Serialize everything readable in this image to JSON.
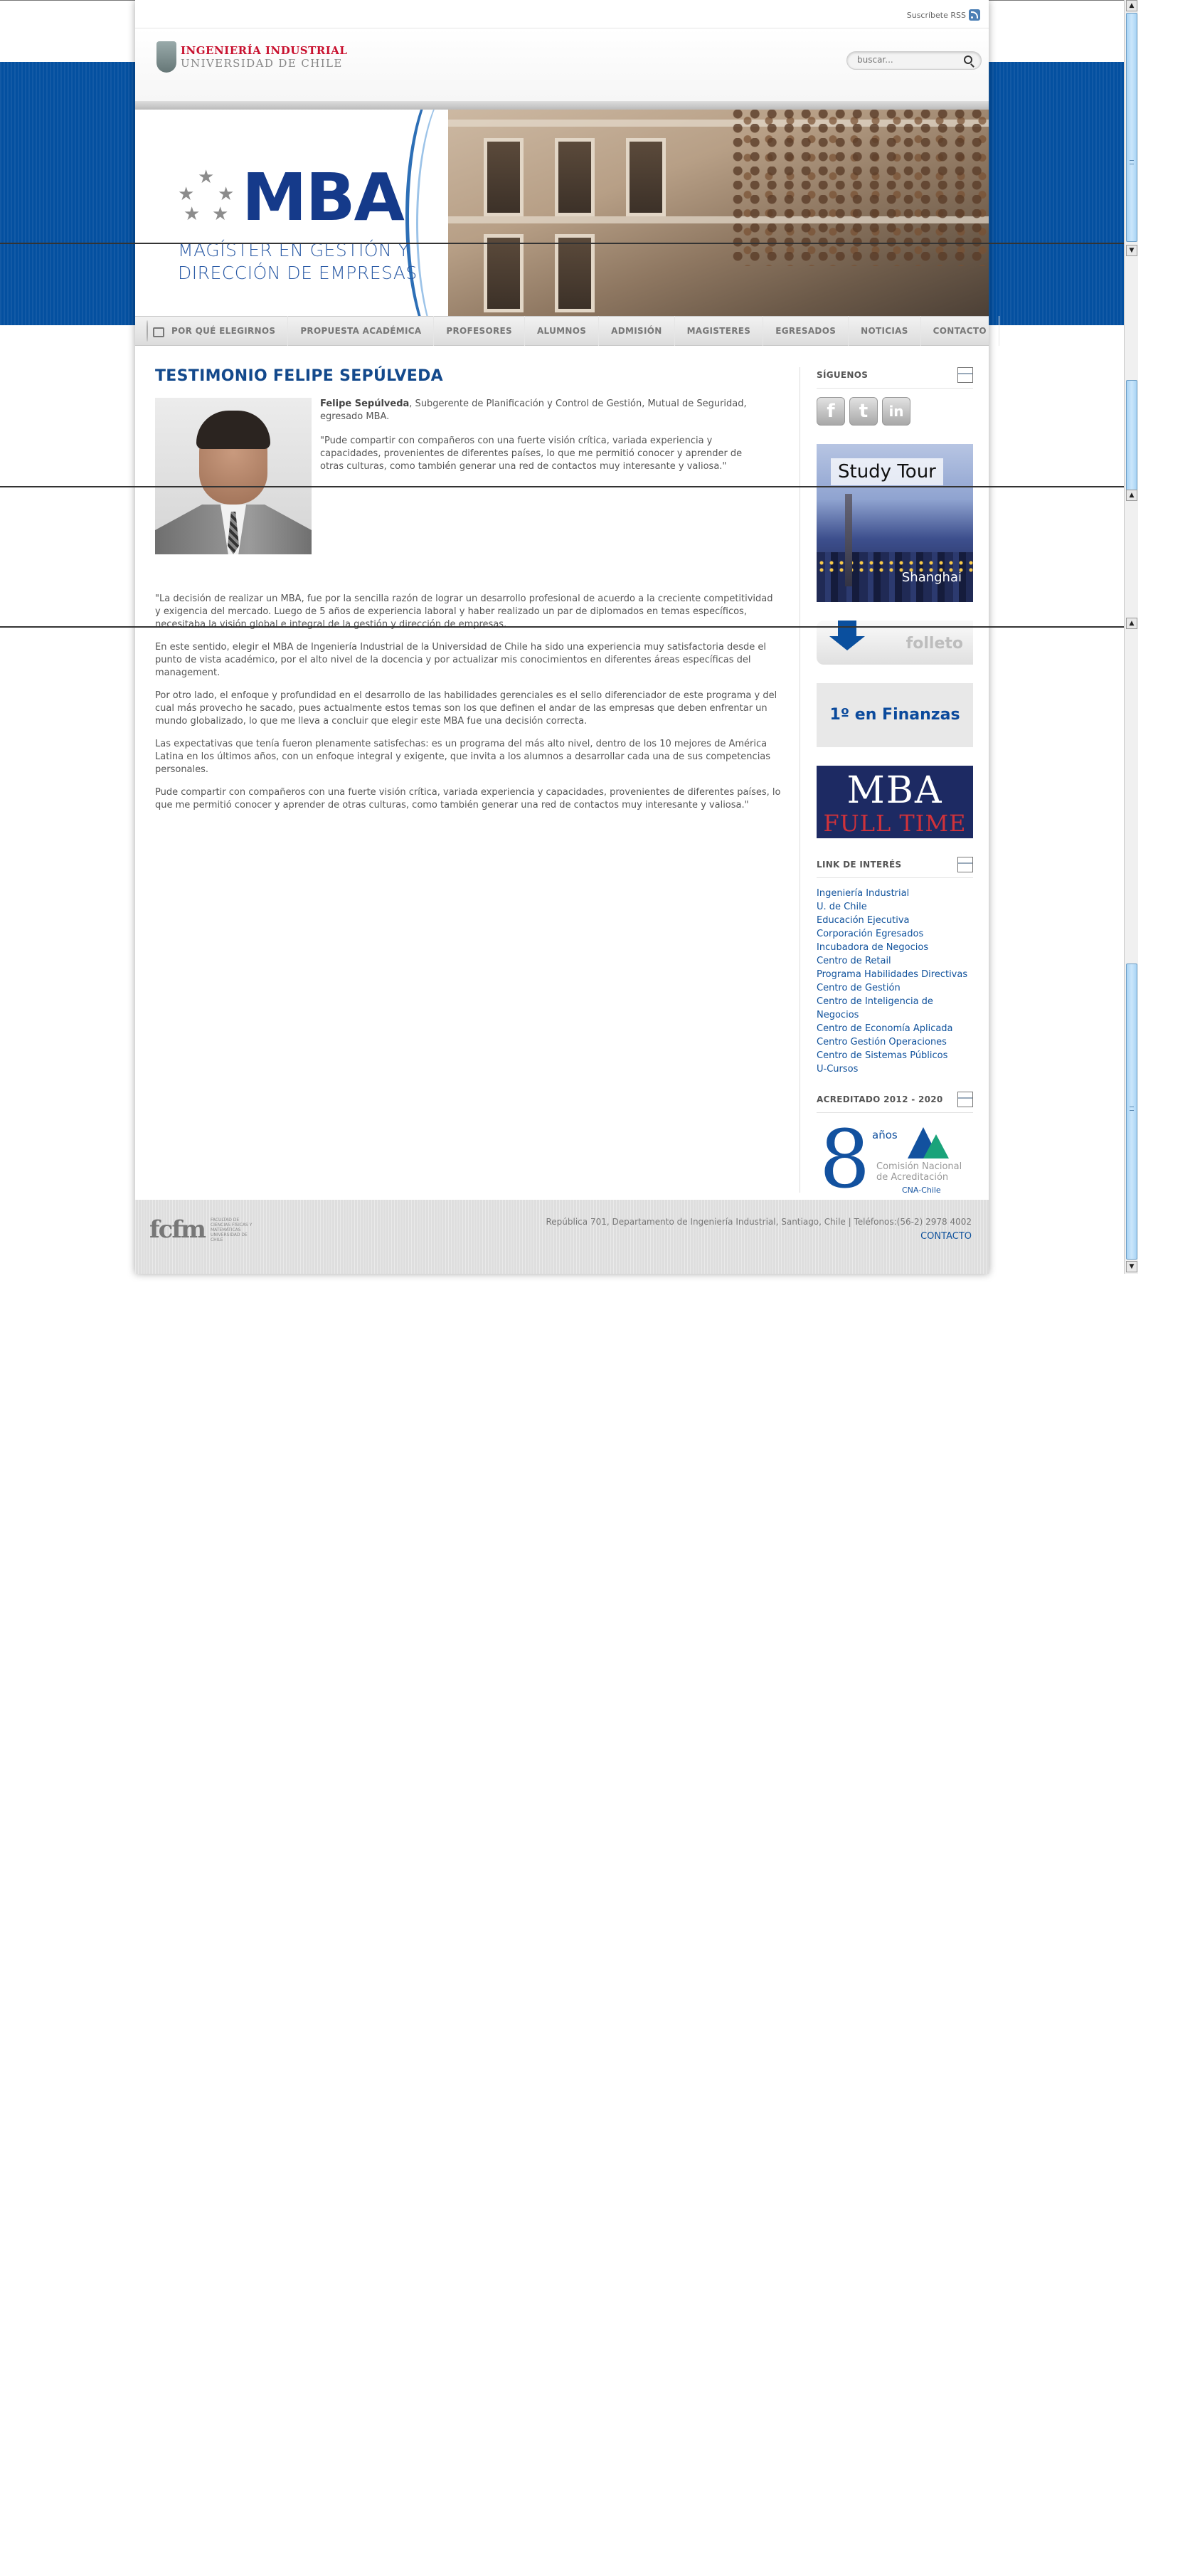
{
  "top": {
    "rss_label": "Suscríbete RSS"
  },
  "header": {
    "logo_line1": "INGENIERÍA INDUSTRIAL",
    "logo_line2": "UNIVERSIDAD DE CHILE",
    "search_placeholder": "buscar..."
  },
  "hero": {
    "mba": "MBA",
    "sub1": "MAGÍSTER EN GESTIÓN Y",
    "sub2": "DIRECCIÓN DE EMPRESAS"
  },
  "nav": {
    "items": [
      "POR QUÉ ELEGIRNOS",
      "PROPUESTA ACADÉMICA",
      "PROFESORES",
      "ALUMNOS",
      "ADMISIÓN",
      "MAGISTERES",
      "EGRESADOS",
      "NOTICIAS",
      "CONTACTO"
    ]
  },
  "main": {
    "title": "TESTIMONIO FELIPE SEPÚLVEDA",
    "intro_name": "Felipe Sepúlveda",
    "intro_role": ", Subgerente de Planificación y Control de Gestión, Mutual de Seguridad, egresado MBA.",
    "intro_quote": "\"Pude compartir con compañeros con una fuerte visión crítica, variada experiencia y capacidades, provenientes de diferentes países, lo que me permitió conocer y aprender de otras culturas, como también generar una red de contactos muy interesante y valiosa.\"",
    "paragraphs": [
      "\"La decisión de realizar un MBA, fue por la sencilla razón de lograr un desarrollo profesional de acuerdo a la creciente competitividad y exigencia del mercado. Luego de 5 años de experiencia laboral y haber realizado un par de diplomados en temas específicos, necesitaba la visión global e integral de la gestión y dirección de empresas.",
      "En este sentido, elegir el MBA de Ingeniería Industrial de la Universidad de Chile ha sido una experiencia muy satisfactoria desde el punto de vista académico, por el alto nivel de la docencia y por actualizar mis conocimientos en diferentes áreas específicas del management.",
      "Por otro lado, el enfoque y profundidad en el desarrollo de las habilidades gerenciales es el sello diferenciador de este programa y del cual más provecho he sacado, pues actualmente estos temas son los que definen el andar de las empresas que deben enfrentar un mundo globalizado, lo que me lleva a concluir que elegir este MBA fue una decisión correcta.",
      "Las expectativas que tenía fueron plenamente satisfechas: es un programa del más alto nivel, dentro de los 10 mejores de América Latina en los últimos años, con un enfoque integral y exigente, que invita a los alumnos a desarrollar cada una de sus competencias personales.",
      "Pude compartir con compañeros con una fuerte visión crítica, variada experiencia y capacidades, provenientes de diferentes países, lo que me permitió conocer y aprender de otras culturas, como también generar una red de contactos muy interesante y valiosa.\""
    ]
  },
  "sidebar": {
    "follow_title": "SÍGUENOS",
    "social": [
      {
        "name": "facebook",
        "glyph": "f"
      },
      {
        "name": "twitter",
        "glyph": "t"
      },
      {
        "name": "linkedin",
        "glyph": "in"
      }
    ],
    "study_tour_label": "Study Tour",
    "study_tour_city": "Shanghai",
    "folleto_label": "folleto",
    "finanzas_label": "1º en Finanzas",
    "mbaft_line1": "MBA",
    "mbaft_line2": "FULL TIME",
    "links_title": "LINK DE INTERÉS",
    "links": [
      "Ingeniería Industrial",
      "U. de Chile",
      "Educación Ejecutiva",
      "Corporación Egresados",
      "Incubadora de Negocios",
      "Centro de Retail",
      "Programa Habilidades Directivas",
      "Centro de Gestión",
      "Centro de Inteligencia de Negocios",
      "Centro de Economía Aplicada",
      "Centro Gestión Operaciones",
      "Centro de Sistemas Públicos",
      "U-Cursos"
    ],
    "acred_title": "ACREDITADO 2012 - 2020",
    "acred_years": "8",
    "acred_years_label": "años",
    "acred_cna": "Comisión Nacional de Acreditación",
    "acred_cna_short": "CNA-Chile"
  },
  "footer": {
    "fcfm_mark": "fcfm",
    "fcfm_small": "FACULTAD DE CIENCIAS FÍSICAS Y MATEMÁTICAS UNIVERSIDAD DE CHILE",
    "address": "República 701, Departamento de Ingeniería Industrial, Santiago, Chile | Teléfonos:(56-2) 2978 4002",
    "contact": "CONTACTO"
  },
  "colors": {
    "brand_blue": "#0450a0",
    "title_blue": "#13498c",
    "link_blue": "#10529c",
    "accent_red": "#c8102e"
  }
}
